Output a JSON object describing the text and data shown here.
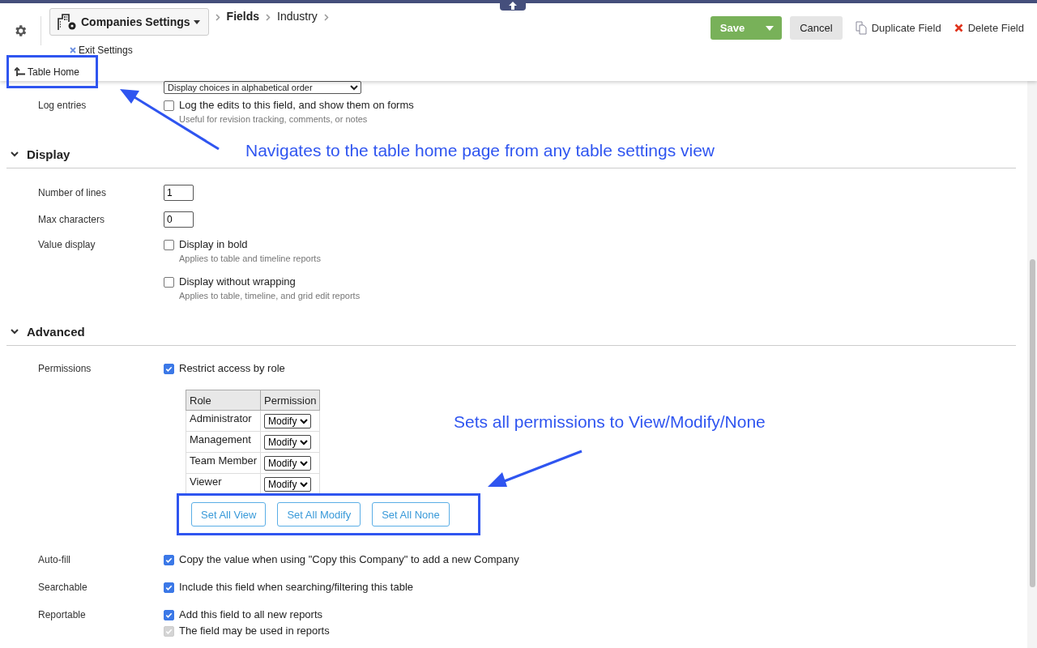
{
  "header": {
    "table_selector": "Companies Settings",
    "breadcrumb": [
      "Fields",
      "Industry"
    ],
    "exit_link": "Exit Settings",
    "table_home_link": "Table Home",
    "save_button": "Save",
    "cancel_button": "Cancel",
    "duplicate_link": "Duplicate Field",
    "delete_link": "Delete Field"
  },
  "top_rows": [
    {
      "kind": "select",
      "label": "",
      "value": "Display choices in alphabetical order"
    },
    {
      "kind": "checkbox",
      "label": "Log entries",
      "options": [
        {
          "text": "Log the edits to this field, and show them on forms",
          "hint": "Useful for revision tracking, comments, or notes",
          "checked": false,
          "disabled": false
        }
      ]
    }
  ],
  "sections": [
    {
      "title": "Display",
      "expanded": true,
      "rows": [
        {
          "kind": "input",
          "label": "Number of lines",
          "value": "1"
        },
        {
          "kind": "input",
          "label": "Max characters",
          "value": "0"
        },
        {
          "kind": "checkbox",
          "label": "Value display",
          "options": [
            {
              "text": "Display in bold",
              "hint": "Applies to table and timeline reports",
              "checked": false,
              "disabled": false
            },
            {
              "text": "Display without wrapping",
              "hint": "Applies to table, timeline, and grid edit reports",
              "checked": false,
              "disabled": false
            }
          ]
        }
      ]
    },
    {
      "title": "Advanced",
      "expanded": true,
      "rows": [
        {
          "kind": "permissions",
          "label": "Permissions",
          "option": {
            "text": "Restrict access by role",
            "checked": true,
            "disabled": false
          },
          "columns": [
            "Role",
            "Permission"
          ],
          "roles": [
            {
              "name": "Administrator",
              "permission": "Modify"
            },
            {
              "name": "Management",
              "permission": "Modify"
            },
            {
              "name": "Team Member",
              "permission": "Modify"
            },
            {
              "name": "Viewer",
              "permission": "Modify"
            }
          ],
          "buttons": [
            "Set All View",
            "Set All Modify",
            "Set All None"
          ]
        },
        {
          "kind": "checkbox",
          "label": "Auto-fill",
          "options": [
            {
              "text": "Copy the value when using \"Copy this Company\" to add a new Company",
              "checked": true,
              "disabled": false
            }
          ]
        },
        {
          "kind": "checkbox",
          "label": "Searchable",
          "options": [
            {
              "text": "Include this field when searching/filtering this table",
              "checked": true,
              "disabled": false
            }
          ]
        },
        {
          "kind": "checkbox",
          "label": "Reportable",
          "options": [
            {
              "text": "Add this field to all new reports",
              "checked": true,
              "disabled": false
            },
            {
              "text": "The field may be used in reports",
              "checked": true,
              "disabled": true
            }
          ]
        }
      ]
    }
  ],
  "annotations": [
    "Navigates to the table home page from any table settings view",
    "Sets all permissions to View/Modify/None"
  ]
}
